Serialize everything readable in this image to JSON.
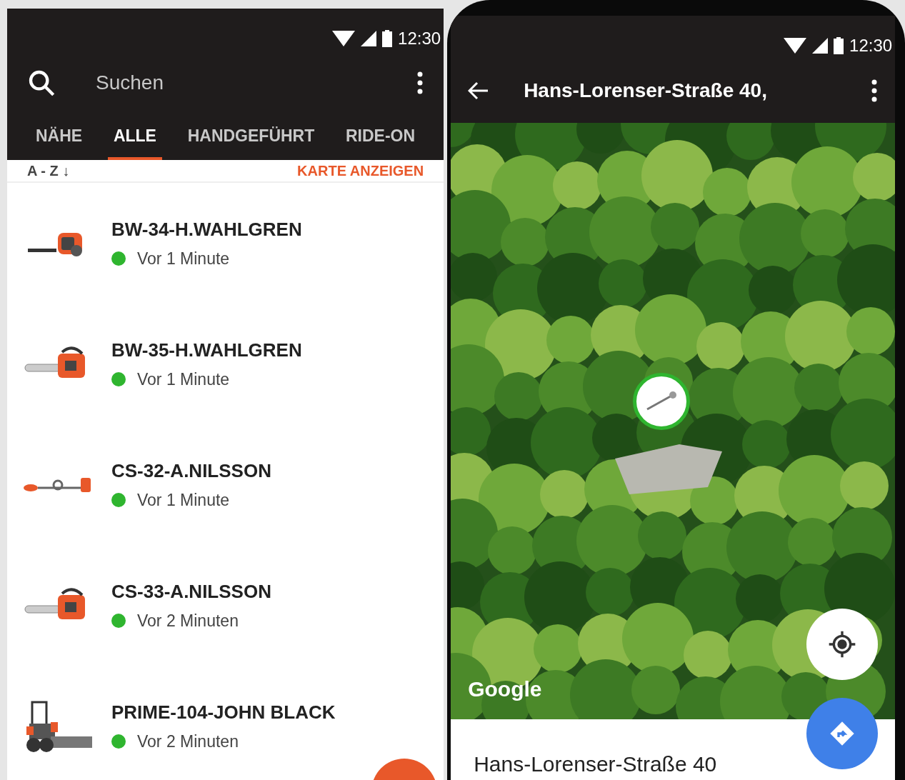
{
  "left_screen": {
    "status_bar": {
      "time": "12:30"
    },
    "search": {
      "placeholder": "Suchen"
    },
    "tabs": [
      {
        "label": "NÄHE",
        "selected": false
      },
      {
        "label": "ALLE",
        "selected": true
      },
      {
        "label": "HANDGEFÜHRT",
        "selected": false
      },
      {
        "label": "RIDE-ON",
        "selected": false
      }
    ],
    "sort": "A - Z ↓",
    "map_link": "KARTE ANZEIGEN",
    "items": [
      {
        "kind": "blower",
        "name": "BW-34-H.WAHLGREN",
        "status": "Vor 1 Minute",
        "color": "#2fb52f"
      },
      {
        "kind": "chainsaw",
        "name": "BW-35-H.WAHLGREN",
        "status": "Vor 1 Minute",
        "color": "#2fb52f"
      },
      {
        "kind": "trimmer",
        "name": "CS-32-A.NILSSON",
        "status": "Vor 1 Minute",
        "color": "#2fb52f"
      },
      {
        "kind": "chainsaw",
        "name": "CS-33-A.NILSSON",
        "status": "Vor 2 Minuten",
        "color": "#2fb52f"
      },
      {
        "kind": "rider",
        "name": "PRIME-104-JOHN BLACK",
        "status": "Vor 2 Minuten",
        "color": "#2fb52f"
      }
    ]
  },
  "right_screen": {
    "status_bar": {
      "time": "12:30"
    },
    "title": "Hans-Lorenser-Straße 40,",
    "map_attribution": "Google",
    "address": "Hans-Lorenser-Straße 40"
  }
}
